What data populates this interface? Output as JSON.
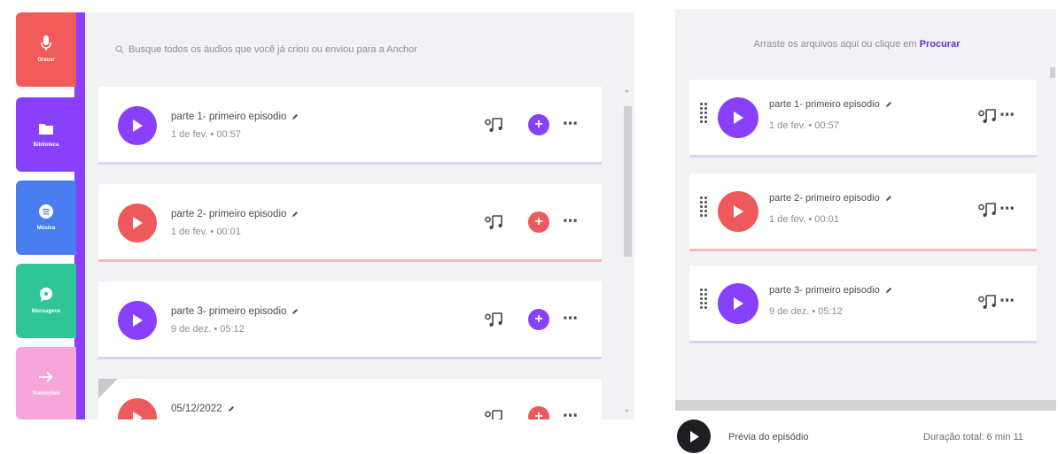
{
  "nav": [
    {
      "label": "Gravar",
      "icon": "microphone-icon",
      "color": "#f05a5b"
    },
    {
      "label": "Biblioteca",
      "icon": "folder-icon",
      "color": "#8940fa"
    },
    {
      "label": "Música",
      "icon": "spotify-icon",
      "color": "#4a7df0"
    },
    {
      "label": "Mensagens",
      "icon": "message-icon",
      "color": "#2fc596"
    },
    {
      "label": "Transições",
      "icon": "arrow-right-icon",
      "color": "#f7a6dc"
    }
  ],
  "library": {
    "search_placeholder": "Busque todos os áudios que você já criou ou enviou para a Anchor",
    "items": [
      {
        "title": "parte 1- primeiro episodio",
        "meta": "1 de fev. • 00:57",
        "color": "purple"
      },
      {
        "title": "parte 2- primeiro episodio",
        "meta": "1 de fev. • 00:01",
        "color": "red"
      },
      {
        "title": "parte 3- primeiro episodio",
        "meta": "9 de dez. • 05:12",
        "color": "purple"
      },
      {
        "title": "05/12/2022",
        "meta": "",
        "color": "red"
      }
    ]
  },
  "episode": {
    "drop_text": "Arraste os arquivos aqui ou clique em",
    "drop_link": "Procurar",
    "items": [
      {
        "title": "parte 1- primeiro episodio",
        "meta": "1 de fev. • 00:57",
        "color": "purple"
      },
      {
        "title": "parte 2- primeiro episodio",
        "meta": "1 de fev. • 00:01",
        "color": "red"
      },
      {
        "title": "parte 3- primeiro episodio",
        "meta": "9 de dez. • 05:12",
        "color": "purple"
      }
    ]
  },
  "preview": {
    "label": "Prévia do episódio",
    "duration": "Duração total: 6 min 11"
  },
  "colors": {
    "purple": "#8940fa",
    "red": "#ee5a5b"
  }
}
